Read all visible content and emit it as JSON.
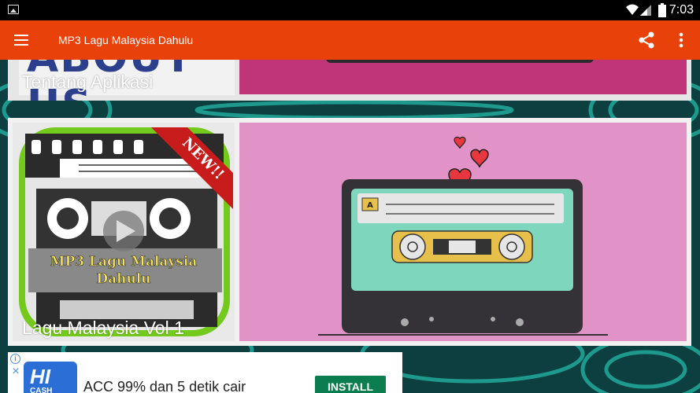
{
  "status_bar": {
    "time": "7:03",
    "icons": [
      "image-notification-icon",
      "wifi-icon",
      "signal-icon",
      "battery-icon"
    ]
  },
  "app_bar": {
    "title": "MP3 Lagu Malaysia Dahulu",
    "color": "#e8410a",
    "icons": [
      "menu-icon",
      "share-icon",
      "more-vert-icon"
    ]
  },
  "cards": [
    {
      "label": "Tentang Aplikasi",
      "thumb_text": "ABOUT US"
    },
    {
      "label": "Lagu Malaysia Vol 1",
      "icon_text": "MP3 Lagu Malaysia Dahulu",
      "ribbon": "NEW!!",
      "cassette_side": "A"
    }
  ],
  "ad": {
    "logo_hi": "HI",
    "logo_cash": "CASH",
    "headline": "ACC 99% dan 5 detik cair",
    "button": "INSTALL",
    "button_color": "#0b7d4e"
  }
}
